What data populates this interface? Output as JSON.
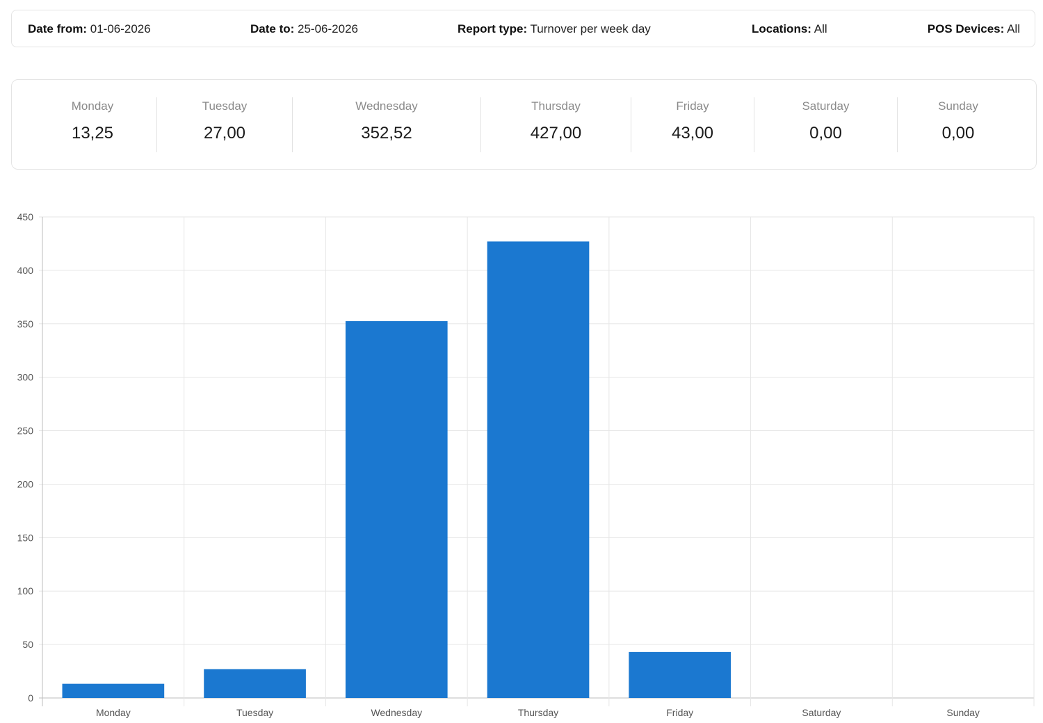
{
  "filters": {
    "date_from_label": "Date from:",
    "date_from_value": "01-06-2026",
    "date_to_label": "Date to:",
    "date_to_value": "25-06-2026",
    "report_type_label": "Report type:",
    "report_type_value": "Turnover per week day",
    "locations_label": "Locations:",
    "locations_value": "All",
    "pos_devices_label": "POS Devices:",
    "pos_devices_value": "All"
  },
  "summary": [
    {
      "day": "Monday",
      "value": "13,25"
    },
    {
      "day": "Tuesday",
      "value": "27,00"
    },
    {
      "day": "Wednesday",
      "value": "352,52"
    },
    {
      "day": "Thursday",
      "value": "427,00"
    },
    {
      "day": "Friday",
      "value": "43,00"
    },
    {
      "day": "Saturday",
      "value": "0,00"
    },
    {
      "day": "Sunday",
      "value": "0,00"
    }
  ],
  "colors": {
    "bar": "#1b78d0",
    "grid": "#e6e6e6",
    "axis": "#bdbdbd"
  },
  "chart_data": {
    "type": "bar",
    "categories": [
      "Monday",
      "Tuesday",
      "Wednesday",
      "Thursday",
      "Friday",
      "Saturday",
      "Sunday"
    ],
    "values": [
      13.25,
      27,
      352.52,
      427,
      43,
      0,
      0
    ],
    "yticks": [
      0,
      50,
      100,
      150,
      200,
      250,
      300,
      350,
      400,
      450
    ],
    "ylim": [
      0,
      450
    ],
    "grid": true,
    "legend": "none"
  }
}
